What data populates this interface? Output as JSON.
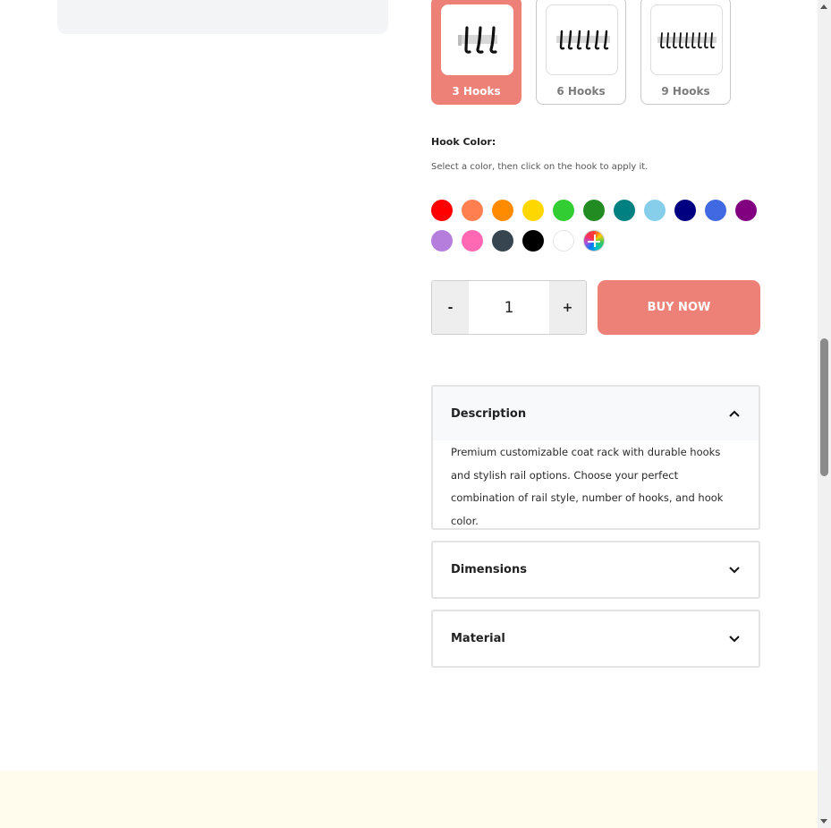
{
  "hook_options": [
    {
      "label": "3 Hooks",
      "selected": true
    },
    {
      "label": "6 Hooks",
      "selected": false
    },
    {
      "label": "9 Hooks",
      "selected": false
    }
  ],
  "hook_color": {
    "title": "Hook Color:",
    "instructions": "Select a color, then click on the hook to apply it.",
    "swatches": [
      {
        "name": "red",
        "hex": "#ff0000"
      },
      {
        "name": "coral",
        "hex": "#ff7f50"
      },
      {
        "name": "orange",
        "hex": "#ff8c00"
      },
      {
        "name": "gold",
        "hex": "#ffd700"
      },
      {
        "name": "lime-green",
        "hex": "#32cd32"
      },
      {
        "name": "forest-green",
        "hex": "#228b22"
      },
      {
        "name": "teal",
        "hex": "#008080"
      },
      {
        "name": "sky-blue",
        "hex": "#87ceeb"
      },
      {
        "name": "navy",
        "hex": "#000080"
      },
      {
        "name": "royal-blue",
        "hex": "#4169e1"
      },
      {
        "name": "purple",
        "hex": "#800080"
      },
      {
        "name": "lavender",
        "hex": "#b57edc"
      },
      {
        "name": "hot-pink",
        "hex": "#ff69b4"
      },
      {
        "name": "charcoal",
        "hex": "#36454f"
      },
      {
        "name": "black",
        "hex": "#000000"
      },
      {
        "name": "white",
        "hex": "#ffffff"
      },
      {
        "name": "custom",
        "hex": "multicolor"
      }
    ]
  },
  "quantity": {
    "minus": "-",
    "value": "1",
    "plus": "+"
  },
  "buy_now": "BUY NOW",
  "accordions": [
    {
      "title": "Description",
      "open": true,
      "body": "Premium customizable coat rack with durable hooks and stylish rail options. Choose your perfect combination of rail style, number of hooks, and hook color."
    },
    {
      "title": "Dimensions",
      "open": false
    },
    {
      "title": "Material",
      "open": false
    }
  ],
  "colors": {
    "accent": "#ed8178",
    "footer_bg": "#fffcee"
  }
}
